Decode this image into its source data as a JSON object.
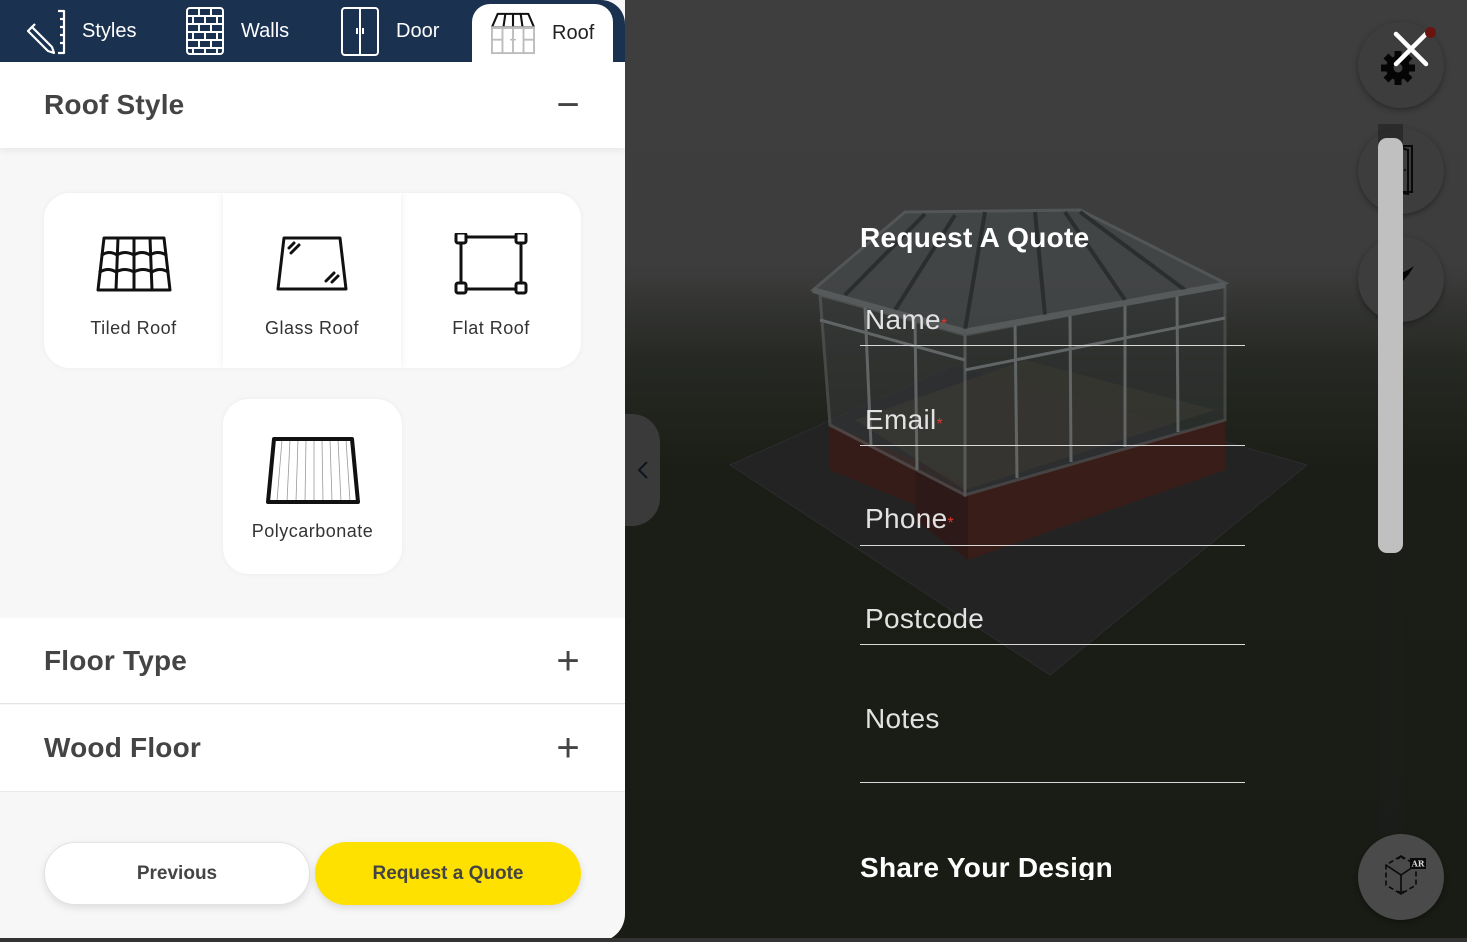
{
  "tabs": [
    {
      "label": "Styles",
      "icon": "pencil-ruler-icon",
      "active": false
    },
    {
      "label": "Walls",
      "icon": "brick-wall-icon",
      "active": false
    },
    {
      "label": "Door",
      "icon": "double-door-icon",
      "active": false
    },
    {
      "label": "Roof",
      "icon": "conservatory-roof-icon",
      "active": true
    }
  ],
  "sections": {
    "roof_style": {
      "title": "Roof Style",
      "toggle": "−",
      "expanded": true
    },
    "floor_type": {
      "title": "Floor Type",
      "toggle": "+",
      "expanded": false
    },
    "wood_floor": {
      "title": "Wood Floor",
      "toggle": "+",
      "expanded": false
    }
  },
  "roof_options": [
    {
      "label": "Tiled Roof",
      "icon": "tiled-roof-icon"
    },
    {
      "label": "Glass Roof",
      "icon": "glass-roof-icon"
    },
    {
      "label": "Flat Roof",
      "icon": "flat-roof-icon"
    },
    {
      "label": "Polycarbonate",
      "icon": "polycarbonate-roof-icon"
    }
  ],
  "footer": {
    "previous_label": "Previous",
    "quote_label": "Request a Quote"
  },
  "quote_form": {
    "title": "Request A Quote",
    "fields": [
      {
        "label": "Name",
        "required": true,
        "value": ""
      },
      {
        "label": "Email",
        "required": true,
        "value": ""
      },
      {
        "label": "Phone",
        "required": true,
        "value": ""
      },
      {
        "label": "Postcode",
        "required": false,
        "value": ""
      },
      {
        "label": "Notes",
        "required": false,
        "value": ""
      }
    ],
    "required_marker": "*",
    "share_title": "Share Your Design"
  },
  "scene_controls": {
    "close": "close-icon",
    "settings": "gear-icon",
    "door_view": "door-icon",
    "fly_view": "plane-icon",
    "ar_view": "ar-cube-icon",
    "ar_badge": "AR"
  },
  "colors": {
    "tabbar": "#1a3150",
    "accent_yellow": "#ffe100",
    "required_red": "#e0372c"
  }
}
